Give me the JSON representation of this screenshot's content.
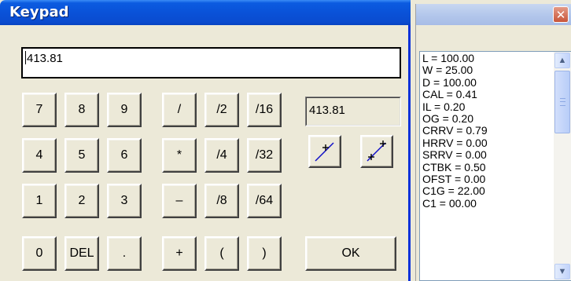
{
  "keypad": {
    "title": "Keypad",
    "display_value": "413.81",
    "readout_value": "413.81",
    "keys": {
      "k7": "7",
      "k8": "8",
      "k9": "9",
      "k4": "4",
      "k5": "5",
      "k6": "6",
      "k1": "1",
      "k2": "2",
      "k3": "3",
      "k0": "0",
      "del": "DEL",
      "dot": ".",
      "div": "/",
      "mul": "*",
      "minus": "–",
      "plus": "+",
      "half": "/2",
      "quarter": "/4",
      "eighth": "/8",
      "sixteenth": "/16",
      "thirtysecond": "/32",
      "sixtyfourth": "/64",
      "lparen": "(",
      "rparen": ")",
      "ok": "OK"
    },
    "icons": [
      "line-plus-up-icon",
      "line-plus-both-icon"
    ]
  },
  "list_window": {
    "close_glyph": "✕",
    "items": [
      "L = 100.00",
      "W = 25.00",
      "D = 100.00",
      "CAL = 0.41",
      "IL = 0.20",
      "OG = 0.20",
      "CRRV = 0.79",
      "HRRV = 0.00",
      "SRRV = 0.00",
      "CTBK = 0.50",
      "OFST = 0.00",
      "C1G = 22.00",
      "C1 = 00.00"
    ]
  },
  "colors": {
    "title_blue": "#0A52D8",
    "face": "#ECE9D8",
    "close_red": "#C8553A"
  }
}
